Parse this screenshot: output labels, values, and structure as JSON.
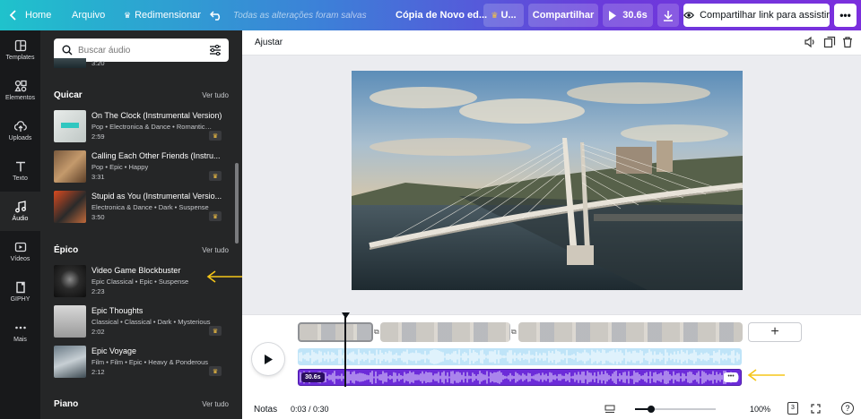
{
  "topbar": {
    "home": "Home",
    "file": "Arquivo",
    "resize": "Redimensionar",
    "saved_status": "Todas as alterações foram salvas",
    "doc_title": "Cópia de Novo ed...",
    "upgrade": "U...",
    "share": "Compartilhar",
    "duration": "30.6s",
    "share_link": "Compartilhar link para assistir"
  },
  "rail": {
    "items": [
      {
        "label": "Templates",
        "icon": "templates-icon"
      },
      {
        "label": "Elementos",
        "icon": "elements-icon"
      },
      {
        "label": "Uploads",
        "icon": "upload-cloud-icon"
      },
      {
        "label": "Texto",
        "icon": "text-icon"
      },
      {
        "label": "Áudio",
        "icon": "music-note-icon"
      },
      {
        "label": "Vídeos",
        "icon": "video-icon"
      },
      {
        "label": "GIPHY",
        "icon": "giphy-icon"
      },
      {
        "label": "Mais",
        "icon": "more-dots-icon"
      }
    ]
  },
  "panel": {
    "search_placeholder": "Buscar áudio",
    "top_partial_duration": "3:20",
    "sections": [
      {
        "title": "Quicar",
        "see_all": "Ver tudo",
        "tracks": [
          {
            "title": "On The Clock (Instrumental Version)",
            "meta": "Pop • Electronica & Dance • Romantic • ...",
            "duration": "2:59"
          },
          {
            "title": "Calling Each Other Friends (Instru...",
            "meta": "Pop • Epic • Happy",
            "duration": "3:31"
          },
          {
            "title": "Stupid as You (Instrumental Versio...",
            "meta": "Electronica & Dance • Dark • Suspense",
            "duration": "3:50"
          }
        ]
      },
      {
        "title": "Épico",
        "see_all": "Ver tudo",
        "tracks": [
          {
            "title": "Video Game Blockbuster",
            "meta": "Epic Classical • Epic • Suspense",
            "duration": "2:23"
          },
          {
            "title": "Epic Thoughts",
            "meta": "Classical • Classical • Dark • Mysterious",
            "duration": "2:02"
          },
          {
            "title": "Epic Voyage",
            "meta": "Film • Film • Epic • Heavy & Ponderous",
            "duration": "2:12"
          }
        ]
      },
      {
        "title": "Piano",
        "see_all": "Ver tudo",
        "tracks": []
      }
    ]
  },
  "editor": {
    "adjust": "Ajustar"
  },
  "timeline": {
    "audio_badge": "30.6s"
  },
  "bottombar": {
    "notes": "Notas",
    "time": "0:03 / 0:30",
    "zoom": "100%",
    "zoom_fraction": 0.2,
    "pages": "3",
    "help": "?"
  },
  "colors": {
    "accent": "#7b2fdd",
    "audio_track": "#6c2bd9",
    "audio_track_light": "#bfe4f8",
    "annotation_arrow": "#f5c518"
  }
}
